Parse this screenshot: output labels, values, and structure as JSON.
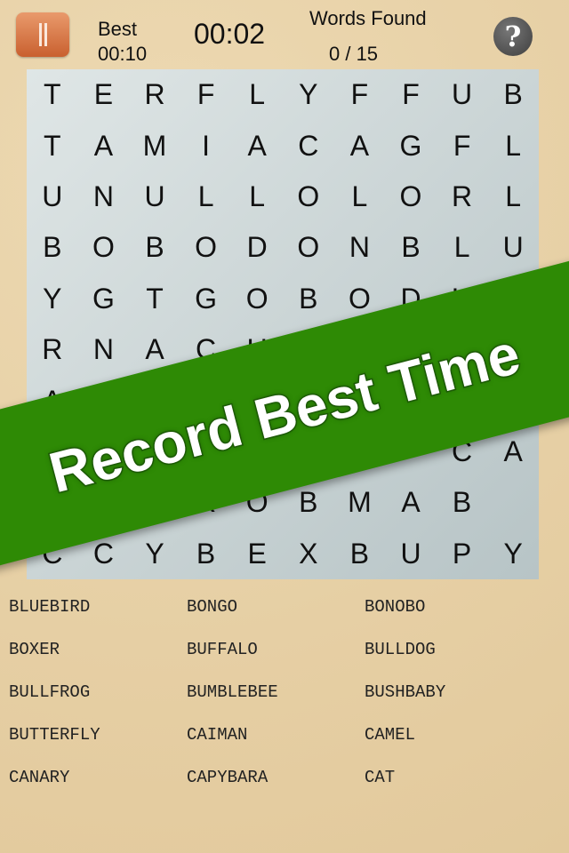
{
  "header": {
    "best_label": "Best",
    "best_time": "00:10",
    "timer": "00:02",
    "words_found_label": "Words Found",
    "words_found": "0 / 15",
    "help_label": "?"
  },
  "grid": [
    [
      "T",
      "E",
      "R",
      "F",
      "L",
      "Y",
      "F",
      "F",
      "U",
      "B"
    ],
    [
      "T",
      "A",
      "M",
      "I",
      "A",
      "C",
      "A",
      "G",
      "F",
      "L"
    ],
    [
      "U",
      "N",
      "U",
      "L",
      "L",
      "O",
      "L",
      "O",
      "R",
      "L"
    ],
    [
      "B",
      "O",
      "B",
      "O",
      "D",
      "O",
      "N",
      "B",
      "L",
      "U"
    ],
    [
      "Y",
      "G",
      "T",
      "G",
      "O",
      "B",
      "O",
      "D",
      "U",
      ""
    ],
    [
      "R",
      "N",
      "A",
      "C",
      "U",
      "",
      "",
      "",
      "",
      ""
    ],
    [
      "A",
      "",
      "",
      "",
      "",
      "",
      "",
      "",
      "",
      ""
    ],
    [
      "",
      "",
      "",
      "",
      "",
      "",
      "",
      "",
      "C",
      "A"
    ],
    [
      "",
      "",
      "",
      "R",
      "O",
      "B",
      "M",
      "A",
      "B",
      ""
    ],
    [
      "C",
      "C",
      "Y",
      "B",
      "E",
      "X",
      "B",
      "U",
      "P",
      "Y"
    ]
  ],
  "words": [
    "BLUEBIRD",
    "BONGO",
    "BONOBO",
    "BOXER",
    "BUFFALO",
    "BULLDOG",
    "BULLFROG",
    "BUMBLEBEE",
    "BUSHBABY",
    "BUTTERFLY",
    "CAIMAN",
    "CAMEL",
    "CANARY",
    "CAPYBARA",
    "CAT"
  ],
  "banner": {
    "text": "Record Best Time",
    "color": "#2e8a05"
  },
  "colors": {
    "pause": "#d36f3e",
    "background": "#e8d2a9"
  }
}
